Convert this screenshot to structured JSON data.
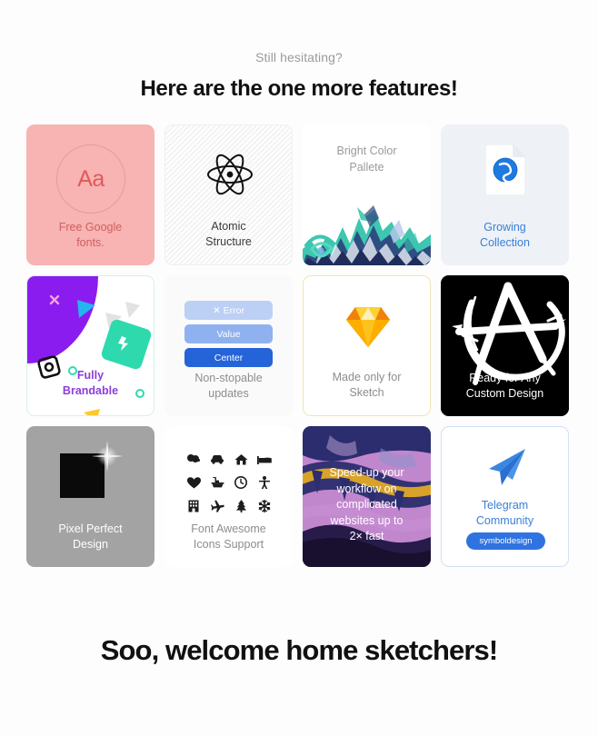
{
  "header": {
    "eyebrow": "Still hesitating?",
    "headline": "Here are the one more features!"
  },
  "cards": [
    {
      "id": "free-google-fonts",
      "label": "Free Google\nfonts.",
      "label_line1": "Free Google",
      "label_line2": "fonts.",
      "art": "Aa",
      "bg": "#f8b3b3",
      "text_color": "#cf5f5f"
    },
    {
      "id": "atomic-structure",
      "label_line1": "Atomic",
      "label_line2": "Structure",
      "icon": "atom-icon",
      "bg": "#ffffff",
      "text_color": "#3a3a3a"
    },
    {
      "id": "bright-color-pallete",
      "title_line1": "Bright Color",
      "title_line2": "Pallete",
      "icon": "paint-splatter-art",
      "bg": "#ffffff",
      "text_color": "#9a9a9a"
    },
    {
      "id": "growing-collection",
      "label_line1": "Growing",
      "label_line2": "Collection",
      "icon": "document-with-logo-icon",
      "bg": "#eef1f6",
      "text_color": "#3a7fd5"
    },
    {
      "id": "fully-brandable",
      "label_line1": "Fully",
      "label_line2": "Brandable",
      "icon": "abstract-shapes-art",
      "bg": "#ffffff",
      "text_color": "#8b3ddd"
    },
    {
      "id": "non-stopable-updates",
      "label_line1": "Non-stopable",
      "label_line2": "updates",
      "bg": "#fafafa",
      "text_color": "#8d8d8d",
      "buttons": [
        {
          "label": "✕ Error",
          "color": "#bcd0f5"
        },
        {
          "label": "Value",
          "color": "#8fb1ef"
        },
        {
          "label": "Center",
          "color": "#2563d9"
        }
      ]
    },
    {
      "id": "made-only-for-sketch",
      "label_line1": "Made only for",
      "label_line2": "Sketch",
      "icon": "sketch-diamond-icon",
      "bg": "#ffffff",
      "border": "#f1e3b4",
      "text_color": "#8d8d8d"
    },
    {
      "id": "ready-for-any-custom-design",
      "label_line1": "Ready for Any",
      "label_line2": "Custom Design",
      "icon": "anarchy-symbol-art",
      "bg": "#000000",
      "text_color": "#ffffff"
    },
    {
      "id": "pixel-perfect-design",
      "label_line1": "Pixel Perfect",
      "label_line2": "Design",
      "icon": "black-square-sparkle-icon",
      "bg": "#a3a3a3",
      "text_color": "#ffffff"
    },
    {
      "id": "font-awesome-icons-support",
      "label_line1": "Font Awesome",
      "label_line2": "Icons Support",
      "bg": "#ffffff",
      "text_color": "#8d8d8d",
      "icons": [
        "tags-icon",
        "car-icon",
        "home-icon",
        "bed-icon",
        "heart-icon",
        "bath-icon",
        "clock-icon",
        "person-icon",
        "building-icon",
        "plane-icon",
        "tree-icon",
        "snowflake-icon"
      ],
      "glyphs": [
        "✿",
        "⛟",
        "⌂",
        "⛌",
        "♥",
        "⛁",
        "◴",
        "⛩",
        "▤",
        "✈",
        "♣",
        "❄"
      ]
    },
    {
      "id": "speed-up-workflow",
      "text_line1": "Speed-up your",
      "text_line2": "workflow on",
      "text_line3": "complicated",
      "text_line4": "websites up to",
      "text_line5": "2× fast",
      "icon": "paint-texture-art",
      "bg": "#b377c4",
      "text_color": "#ffffff"
    },
    {
      "id": "telegram-community",
      "label_line1": "Telegram",
      "label_line2": "Community",
      "icon": "paper-plane-icon",
      "button_label": "symboldesign",
      "button_color": "#2f73e0",
      "bg": "#ffffff",
      "border": "#cfe0f7",
      "text_color": "#3a7fd5"
    }
  ],
  "footer": {
    "headline": "Soo, welcome home sketchers!"
  }
}
